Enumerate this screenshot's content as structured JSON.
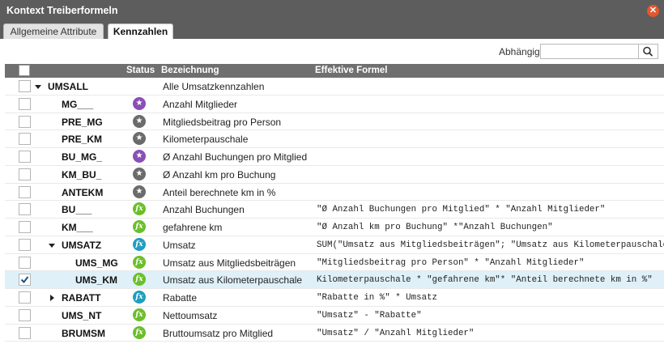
{
  "dialog": {
    "title": "Kontext Treiberformeln",
    "close_glyph": "✕"
  },
  "tabs": [
    {
      "label": "Allgemeine Attribute",
      "active": false
    },
    {
      "label": "Kennzahlen",
      "active": true
    }
  ],
  "toolbar": {
    "search_label": "Abhängig",
    "search_value": "",
    "search_icon": "search-icon"
  },
  "grid": {
    "columns": [
      "Status",
      "Bezeichnung",
      "Effektive Formel"
    ],
    "rows": [
      {
        "code": "UMSALL",
        "level": 0,
        "toggle": "expanded",
        "checked": false,
        "status": "",
        "description": "Alle Umsatzkennzahlen",
        "formula": ""
      },
      {
        "code": "MG___",
        "level": 2,
        "toggle": "",
        "checked": false,
        "status": "input-purple",
        "description": "Anzahl Mitglieder",
        "formula": ""
      },
      {
        "code": "PRE_MG",
        "level": 2,
        "toggle": "",
        "checked": false,
        "status": "input-gray",
        "description": "Mitgliedsbeitrag pro Person",
        "formula": ""
      },
      {
        "code": "PRE_KM",
        "level": 2,
        "toggle": "",
        "checked": false,
        "status": "input-gray",
        "description": "Kilometerpauschale",
        "formula": ""
      },
      {
        "code": "BU_MG_",
        "level": 2,
        "toggle": "",
        "checked": false,
        "status": "input-purple",
        "description": "Ø Anzahl Buchungen pro Mitglied",
        "formula": ""
      },
      {
        "code": "KM_BU_",
        "level": 2,
        "toggle": "",
        "checked": false,
        "status": "input-gray",
        "description": "Ø Anzahl km pro Buchung",
        "formula": ""
      },
      {
        "code": "ANTEKM",
        "level": 2,
        "toggle": "",
        "checked": false,
        "status": "input-gray",
        "description": "Anteil berechnete km in %",
        "formula": ""
      },
      {
        "code": "BU___",
        "level": 2,
        "toggle": "",
        "checked": false,
        "status": "formula-green",
        "description": "Anzahl Buchungen",
        "formula": "\"Ø Anzahl Buchungen pro Mitglied\" * \"Anzahl Mitglieder\""
      },
      {
        "code": "KM___",
        "level": 2,
        "toggle": "",
        "checked": false,
        "status": "formula-green",
        "description": "gefahrene km",
        "formula": "\"Ø Anzahl km pro Buchung\" *\"Anzahl Buchungen\""
      },
      {
        "code": "UMSATZ",
        "level": 1,
        "toggle": "expanded",
        "checked": false,
        "status": "formula-teal",
        "description": "Umsatz",
        "formula": "SUM(\"Umsatz aus Mitgliedsbeiträgen\"; \"Umsatz aus Kilometerpauschale\")"
      },
      {
        "code": "UMS_MG",
        "level": 3,
        "toggle": "",
        "checked": false,
        "status": "formula-green",
        "description": "Umsatz aus Mitgliedsbeiträgen",
        "formula": "\"Mitgliedsbeitrag pro Person\" * \"Anzahl Mitglieder\""
      },
      {
        "code": "UMS_KM",
        "level": 3,
        "toggle": "",
        "checked": true,
        "status": "formula-green",
        "description": "Umsatz aus Kilometerpauschale",
        "formula": "Kilometerpauschale * \"gefahrene km\"* \"Anteil berechnete km in %\""
      },
      {
        "code": "RABATT",
        "level": 1,
        "toggle": "collapsed",
        "checked": false,
        "status": "formula-teal",
        "description": "Rabatte",
        "formula": "\"Rabatte in %\" * Umsatz"
      },
      {
        "code": "UMS_NT",
        "level": 2,
        "toggle": "",
        "checked": false,
        "status": "formula-green",
        "description": "Nettoumsatz",
        "formula": "\"Umsatz\" - \"Rabatte\""
      },
      {
        "code": "BRUMSM",
        "level": 2,
        "toggle": "",
        "checked": false,
        "status": "formula-green",
        "description": "Bruttoumsatz pro Mitglied",
        "formula": "\"Umsatz\" / \"Anzahl Mitglieder\""
      }
    ]
  },
  "status_colors": {
    "input-purple": "#8a4fb5",
    "input-gray": "#6b6b6b",
    "formula-green": "#6bbf2a",
    "formula-teal": "#1f9ec2"
  },
  "status_glyphs": {
    "input-purple": "★",
    "input-gray": "★",
    "formula-green": "fx",
    "formula-teal": "fx"
  }
}
